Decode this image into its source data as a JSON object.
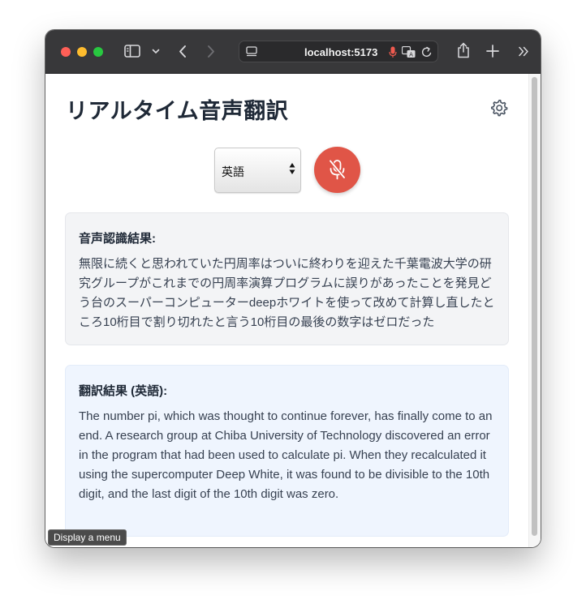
{
  "browser": {
    "url": "localhost:5173",
    "icons": [
      "sidebar-icon",
      "chevron-down-icon",
      "back-icon",
      "forward-icon",
      "page-settings-icon",
      "microphone-icon",
      "translate-icon",
      "reload-icon",
      "share-icon",
      "new-tab-icon",
      "more-icon"
    ]
  },
  "header": {
    "title": "リアルタイム音声翻訳",
    "settings_icon": "gear-icon"
  },
  "controls": {
    "language_selected": "英語",
    "mic_icon": "microphone-off-icon",
    "mic_button_color": "#e05547"
  },
  "recognition": {
    "title": "音声認識結果:",
    "text": "無限に続くと思われていた円周率はついに終わりを迎えた千葉電波大学の研究グループがこれまでの円周率演算プログラムに誤りがあったことを発見どう台のスーパーコンピューターdeepホワイトを使って改めて計算し直したところ10桁目で割り切れたと言う10桁目の最後の数字はゼロだった"
  },
  "translation": {
    "title": "翻訳結果 (英語):",
    "text": "The number pi, which was thought to continue forever, has finally come to an end. A research group at Chiba University of Technology discovered an error in the program that had been used to calculate pi. When they recalculated it using the supercomputer Deep White, it was found to be divisible to the 10th digit, and the last digit of the 10th digit was zero."
  },
  "tooltip": {
    "text": "Display a menu"
  }
}
